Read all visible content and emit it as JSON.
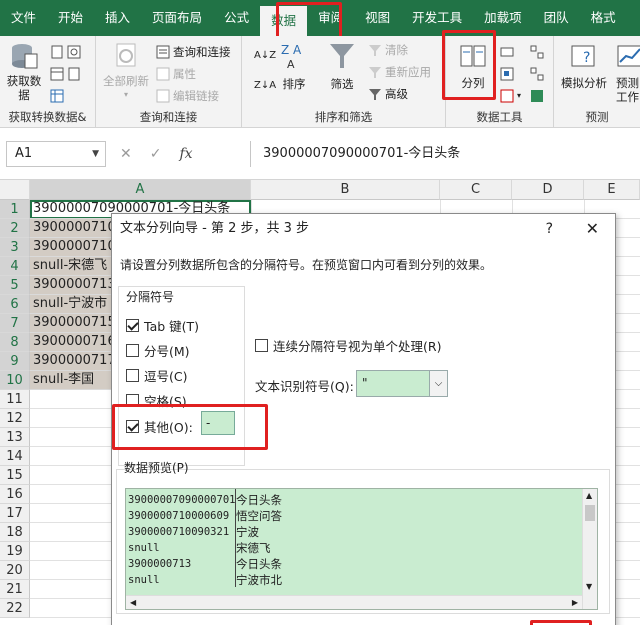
{
  "ribbon_tabs": [
    "文件",
    "开始",
    "插入",
    "页面布局",
    "公式",
    "数据",
    "审阅",
    "视图",
    "开发工具",
    "加载项",
    "团队",
    "格式"
  ],
  "ribbon": {
    "get_data_line1": "获取数",
    "get_data_line2": "据",
    "get_group": "获取转换数据&",
    "refresh_all": "全部刷新",
    "query_connect": "查询和连接",
    "properties": "属性",
    "edit_links": "编辑链接",
    "query_group": "查询和连接",
    "sort": "排序",
    "filter": "筛选",
    "clear": "清除",
    "reapply": "重新应用",
    "advanced": "高级",
    "sort_group": "排序和筛选",
    "text_to_columns": "分列",
    "data_tools_group": "数据工具",
    "what_if": "模拟分析",
    "forecast_line1": "预测",
    "forecast_line2": "工作",
    "forecast_group": "预测"
  },
  "formula_bar": {
    "name_box": "A1",
    "fx": "fx",
    "content": "39000007090000701-今日头条"
  },
  "columns": [
    "A",
    "B",
    "C",
    "D",
    "E"
  ],
  "rows": [
    "1",
    "2",
    "3",
    "4",
    "5",
    "6",
    "7",
    "8",
    "9",
    "10",
    "11",
    "12",
    "13",
    "14",
    "15",
    "16",
    "17",
    "18",
    "19",
    "20",
    "21",
    "22"
  ],
  "cells": [
    "39000007090000701-今日头条",
    "3900000710",
    "3900000710",
    "snull-宋德飞",
    "3900000713",
    "snull-宁波市",
    "3900000715",
    "3900000716",
    "3900000717",
    "snull-李国"
  ],
  "dialog": {
    "title": "文本分列向导 - 第 2 步，共 3 步",
    "help": "?",
    "close": "✕",
    "description": "请设置分列数据所包含的分隔符号。在预览窗口内可看到分列的效果。",
    "delimiters_label": "分隔符号",
    "tab": "Tab 键(T)",
    "semicolon": "分号(M)",
    "comma": "逗号(C)",
    "space": "空格(S)",
    "other": "其他(O):",
    "other_value": "-",
    "consecutive": "连续分隔符号视为单个处理(R)",
    "qualifier_label": "文本识别符号(Q):",
    "qualifier_value": "\"",
    "preview_label": "数据预览(P)",
    "preview_col1": [
      "39000007090000701",
      "3900000710000609",
      "3900000710090321",
      "snull",
      "3900000713",
      "snull"
    ],
    "preview_col2": [
      "今日头条",
      "悟空问答",
      "宁波",
      "宋德飞",
      "今日头条",
      "宁波市北"
    ]
  },
  "states": {
    "tab_checked": true,
    "semicolon_checked": false,
    "comma_checked": false,
    "space_checked": false,
    "other_checked": true,
    "consecutive_checked": false
  },
  "colors": {
    "excel_green": "#217346",
    "highlight": "#e02020",
    "preview_green": "#c9ecd0",
    "selection": "#d3ccc4"
  }
}
